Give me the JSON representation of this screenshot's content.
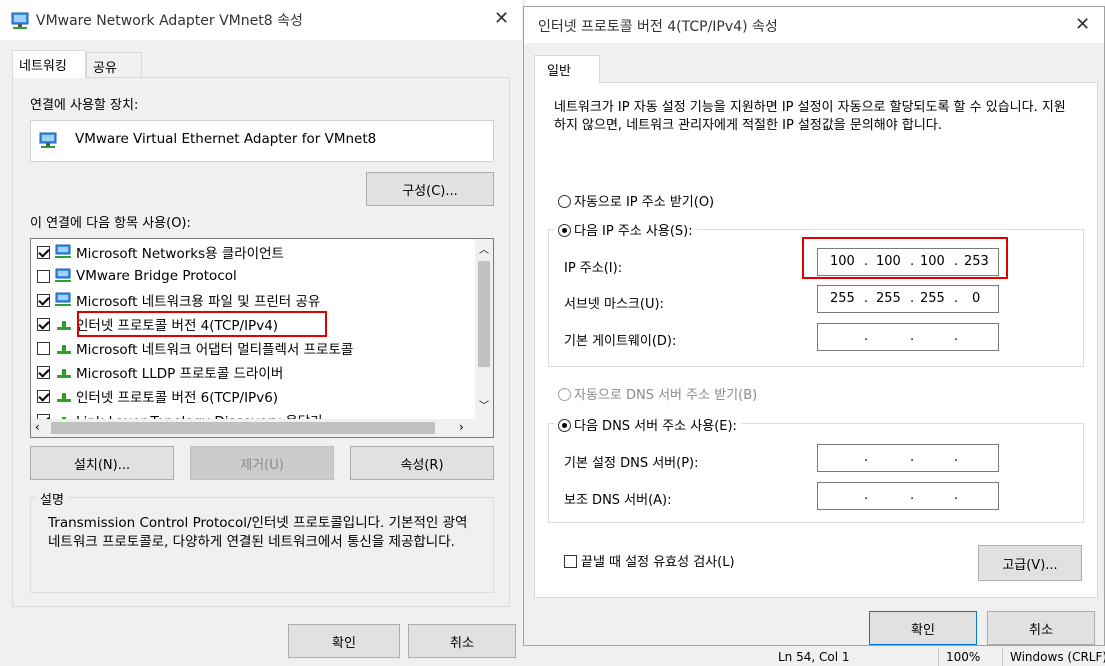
{
  "left_window": {
    "title": "VMware Network Adapter VMnet8 속성",
    "tabs": [
      "네트워킹",
      "공유"
    ],
    "connect_using_label": "연결에 사용할 장치:",
    "adapter_name": "VMware Virtual Ethernet Adapter for VMnet8",
    "configure_button": "구성(C)...",
    "items_label": "이 연결에 다음 항목 사용(O):",
    "items": [
      {
        "label": "Microsoft Networks용 클라이언트",
        "checked": true
      },
      {
        "label": "VMware Bridge Protocol",
        "checked": false
      },
      {
        "label": "Microsoft 네트워크용 파일 및 프린터 공유",
        "checked": true
      },
      {
        "label": "인터넷 프로토콜 버전 4(TCP/IPv4)",
        "checked": true
      },
      {
        "label": "Microsoft 네트워크 어댑터 멀티플렉서 프로토콜",
        "checked": false
      },
      {
        "label": "Microsoft LLDP 프로토콜 드라이버",
        "checked": true
      },
      {
        "label": "인터넷 프로토콜 버전 6(TCP/IPv6)",
        "checked": true
      },
      {
        "label": "Link-Layer Topology Discovery 응답기",
        "checked": true
      }
    ],
    "install_button": "설치(N)...",
    "uninstall_button": "제거(U)",
    "properties_button": "속성(R)",
    "description_title": "설명",
    "description_text": "Transmission Control Protocol/인터넷 프로토콜입니다. 기본적인 광역 네트워크 프로토콜로, 다양하게 연결된 네트워크에서 통신을 제공합니다.",
    "ok_button": "확인",
    "cancel_button": "취소"
  },
  "right_window": {
    "title": "인터넷 프로토콜 버전 4(TCP/IPv4) 속성",
    "tab": "일반",
    "intro_text": "네트워크가 IP 자동 설정 기능을 지원하면 IP 설정이 자동으로 할당되도록 할 수 있습니다. 지원하지 않으면, 네트워크 관리자에게 적절한 IP 설정값을 문의해야 합니다.",
    "auto_ip_radio": "자동으로 IP 주소 받기(O)",
    "manual_ip_radio": "다음 IP 주소 사용(S):",
    "ip_label": "IP 주소(I):",
    "ip_value": [
      "100",
      "100",
      "100",
      "253"
    ],
    "subnet_label": "서브넷 마스크(U):",
    "subnet_value": [
      "255",
      "255",
      "255",
      "0"
    ],
    "gateway_label": "기본 게이트웨이(D):",
    "auto_dns_radio": "자동으로 DNS 서버 주소 받기(B)",
    "manual_dns_radio": "다음 DNS 서버 주소 사용(E):",
    "dns1_label": "기본 설정 DNS 서버(P):",
    "dns2_label": "보조 DNS 서버(A):",
    "validate_label": "끝낼 때 설정 유효성 검사(L)",
    "advanced_button": "고급(V)...",
    "ok_button": "확인",
    "cancel_button": "취소"
  },
  "background": {
    "status_position": "Ln 54, Col 1",
    "status_zoom": "100%",
    "status_encoding": "Windows (CRLF)"
  },
  "colors": {
    "highlight": "#e00000",
    "accent": "#0078d7"
  }
}
